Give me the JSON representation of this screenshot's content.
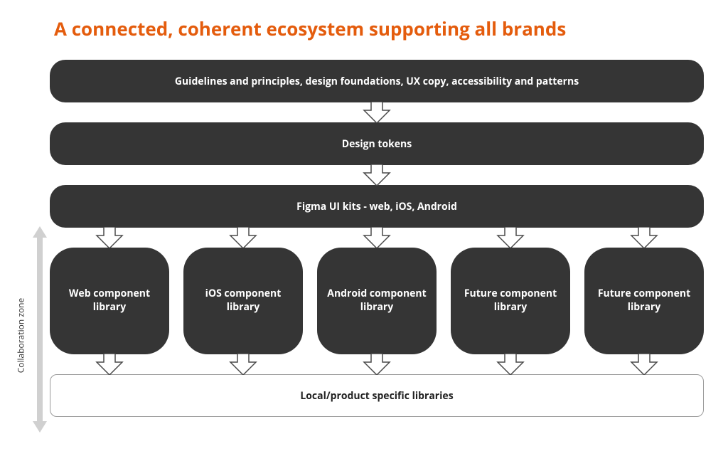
{
  "title": "A connected, coherent ecosystem supporting all brands",
  "collab_label": "Collaboration zone",
  "layers": {
    "guidelines": "Guidelines and principles, design foundations, UX copy, accessibility and patterns",
    "tokens": "Design tokens",
    "figma": "Figma UI kits - web, iOS, Android",
    "local": "Local/product specific libraries"
  },
  "cards": [
    {
      "label": "Web component library"
    },
    {
      "label": "iOS component library"
    },
    {
      "label": "Android component library"
    },
    {
      "label": "Future component library"
    },
    {
      "label": "Future component library"
    }
  ],
  "colors": {
    "accent": "#e45c0d",
    "block": "#353535",
    "arrow_border": "#4a4a4a",
    "collab_arrow": "#d0d0d0"
  }
}
